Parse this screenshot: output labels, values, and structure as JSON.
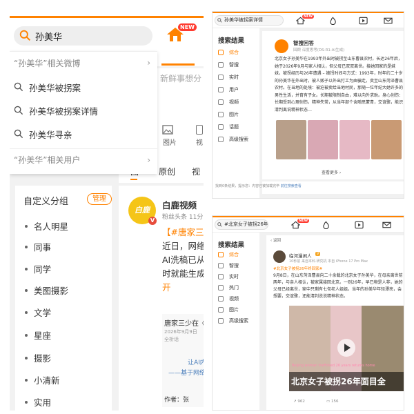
{
  "left": {
    "search_query": "孙美华",
    "new_badge": "NEW",
    "dropdown": {
      "related_weibo": "“孙美华”相关微博",
      "suggestions": [
        "孙美华被拐案",
        "孙美华被拐案详情",
        "孙美华寻亲"
      ],
      "related_users": "“孙美华”相关用户"
    },
    "composer_placeholder": "新鲜事想分",
    "composer_actions": [
      "图片",
      "视"
    ],
    "feed_tabs": [
      "图",
      "原创",
      "视"
    ],
    "nav": {
      "title": "自定义分组",
      "manage": "管理",
      "items": [
        "名人明星",
        "同事",
        "同学",
        "美图摄影",
        "文学",
        "星座",
        "摄影",
        "小清新",
        "实用"
      ]
    },
    "post": {
      "avatar_text": "白鹿",
      "author": "白鹿视频",
      "meta": "粉丝头条  11分",
      "text_lines": [
        "【#唐家三",
        "近日，网络",
        "AI洗稿已从",
        "时就能生成",
        "开"
      ],
      "inner_title": "唐家三少在《",
      "inner_meta": "2026年9月9日",
      "inner_meta2": "全析话",
      "inner_link1": "让AI内",
      "inner_link2": "——基于网络",
      "inner_author": "作者：张"
    }
  },
  "r1": {
    "search_value": "孙美华被拐案详情",
    "new_badge": "NEW",
    "sidebar_title": "搜索结果",
    "sidebar_items": [
      "综合",
      "智搜",
      "实时",
      "用户",
      "视频",
      "图片",
      "话题",
      "高级搜索"
    ],
    "ai_name": "智搜回答",
    "ai_meta": "回顾 深度思考(DS-R1-AI生成)",
    "ai_text": "北京女子孙美华在1993年外出时被拐至山东曹县农村，长达26年后，她于2026年9月与家人相认，但父母已双双离世。接她回家的是妹妹。被拐经历与26年遭遇 – 被拐时间与方式：1993年，时年约二十岁的孙美华在外出时，被人贩子以外出打工为由骗走，卖至山东菏泽曹县农村。在当地的处境：被迫被卖给当地村民，那随一位年纪大她许多的男性生活，并育有子女。长期被限制自由，难以向外求助。身心创伤：长期受到心理创伤，精神失常，从当年部个含随思蒙青，交谊骤，能识清判离说精神状态…",
    "more": "查看更多 ›",
    "footer": "找到0条结果，提示您：内容已被加载完毕 ",
    "footer_link": "前往搜索查看"
  },
  "r2": {
    "search_value": "#北京女子被拐26年终",
    "new_badge": "NEW",
    "sidebar_title": "搜索结果",
    "sidebar_items": [
      "综合",
      "智搜",
      "实时",
      "热门",
      "视频",
      "图片",
      "高级搜索"
    ],
    "back": "‹ 返回",
    "author": "临河漫闲人",
    "author_meta": "10秒前 来自本科·研究机 本自 iPhone 17 Pro Max",
    "tag": "#北京女子被拐26年终回家#",
    "text": "9月8日，在山东菏泽曹县向二十余载的北京女子孙美华，在母亲离世前两年，与亲人相认，被家属接回北京。一则26年，早已物是人非，她的父母已经离世，家中只剩有七旬老人姐姐。当年的孙美华年轻漂亮，会想要，交谊骤，还能清判说说精神状态。",
    "video_caption": "Beijing woman trafficked 26 years returns home",
    "video_title": "北京女子被拐26年面目全",
    "likes": "962",
    "comments": "156"
  }
}
